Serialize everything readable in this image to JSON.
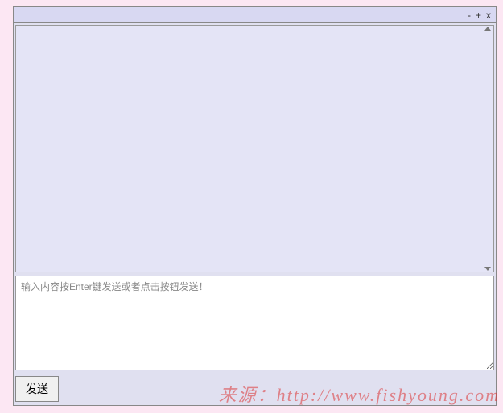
{
  "titlebar": {
    "minimize_label": "-",
    "maximize_label": "+",
    "close_label": "x"
  },
  "input": {
    "placeholder": "输入内容按Enter键发送或者点击按钮发送！",
    "value": ""
  },
  "buttons": {
    "send_label": "发送"
  },
  "watermark": {
    "text": "来源：http://www.fishyoung.com"
  }
}
